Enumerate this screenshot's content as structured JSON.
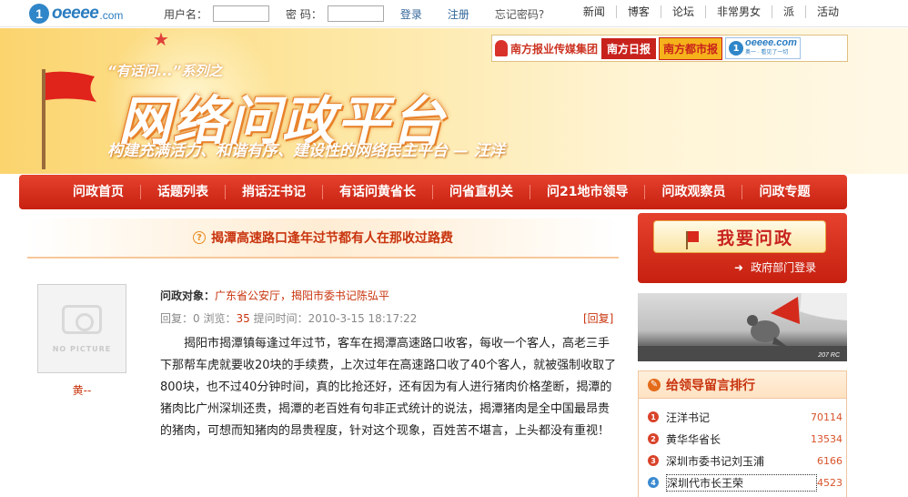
{
  "topbar": {
    "logo_text": "oeeee",
    "logo_dotcom": ".com",
    "logo_badge": "1",
    "username_label": "用户名：",
    "password_label": "密  码：",
    "login_label": "登录",
    "register_label": "注册",
    "forgot_label": "忘记密码?",
    "nav": [
      "新闻",
      "博客",
      "论坛",
      "非常男女",
      "派",
      "活动"
    ]
  },
  "banner": {
    "series_label": "“有话问...”系列之",
    "title": "网络问政平台",
    "slogan": "构建充满活力、和谐有序、建设性的网络民主平台 — 汪洋",
    "partners": {
      "group": "南方报业传媒集团",
      "daily": "南方日报",
      "metro": "南方都市报",
      "oeeee": "oeeee.com",
      "oeeee_sub": "奥一 · 看见了一切"
    }
  },
  "mainnav": [
    "问政首页",
    "话题列表",
    "捎话汪书记",
    "有话问黄省长",
    "问省直机关",
    "问21地市领导",
    "问政观察员",
    "问政专题"
  ],
  "post": {
    "headline": "揭潭高速路口逢年过节都有人在那收过路费",
    "avatar_text": "NO PICTURE",
    "author": "黄--",
    "target_label": "问政对象：",
    "target_value": "广东省公安厅，揭阳市委书记陈弘平",
    "reply_label": "回复：",
    "reply_count": "0",
    "view_label": "浏览：",
    "view_count": "35",
    "time_label": "提问时间：",
    "time_value": "2010-3-15 18:17:22",
    "reply_link": "[回复]",
    "body": "揭阳市揭潭镇每逢过年过节，客车在揭潭高速路口收客，每收一个客人，高老三手下那帮车虎就要收20块的手续费，上次过年在高速路口收了40个客人，就被强制收取了800块，也不过40分钟时间，真的比抢还好，还有因为有人进行猪肉价格垄断，揭潭的猪肉比广州深圳还贵，揭潭的老百姓有句非正式统计的说法，揭潭猪肉是全中国最昂贵的猪肉，可想而知猪肉的昂贵程度，针对这个现象，百姓苦不堪言，上头都没有重视！"
  },
  "sidebar": {
    "ask_button": "我要问政",
    "gov_login": "政府部门登录",
    "promo_brand": "207 RC",
    "rank_title": "给领导留言排行",
    "rank": [
      {
        "num": "1",
        "name": "汪洋书记",
        "count": "70114"
      },
      {
        "num": "2",
        "name": "黄华华省长",
        "count": "13534"
      },
      {
        "num": "3",
        "name": "深圳市委书记刘玉浦",
        "count": "6166"
      },
      {
        "num": "4",
        "name": "深圳代市长王荣",
        "count": "4523"
      }
    ]
  },
  "colors": {
    "nav_red": "#d5301e",
    "accent_red": "#c8340e",
    "link_blue": "#336699"
  }
}
